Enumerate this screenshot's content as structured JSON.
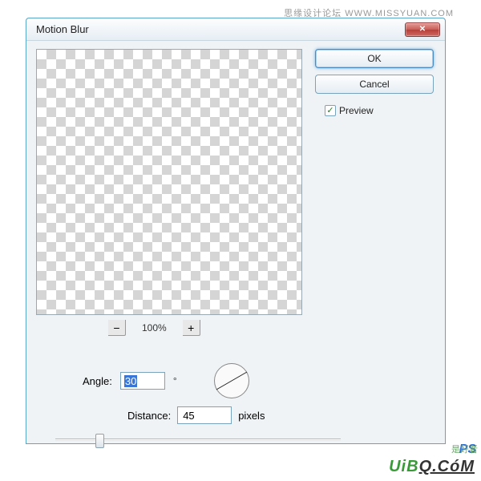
{
  "watermark_top": "思缘设计论坛  WWW.MISSYUAN.COM",
  "dialog": {
    "title": "Motion Blur",
    "close_glyph": "✕",
    "ok_label": "OK",
    "cancel_label": "Cancel",
    "preview_label": "Preview",
    "preview_checked": "✓",
    "zoom": {
      "minus": "−",
      "value": "100%",
      "plus": "+"
    },
    "angle": {
      "label": "Angle:",
      "value": "30",
      "degree": "°"
    },
    "distance": {
      "label": "Distance:",
      "value": "45",
      "unit": "pixels"
    }
  },
  "watermark_bottom": {
    "ps": "PS",
    "jp": "是好者",
    "site1": "UiB",
    "site2": "Q.CóM"
  }
}
